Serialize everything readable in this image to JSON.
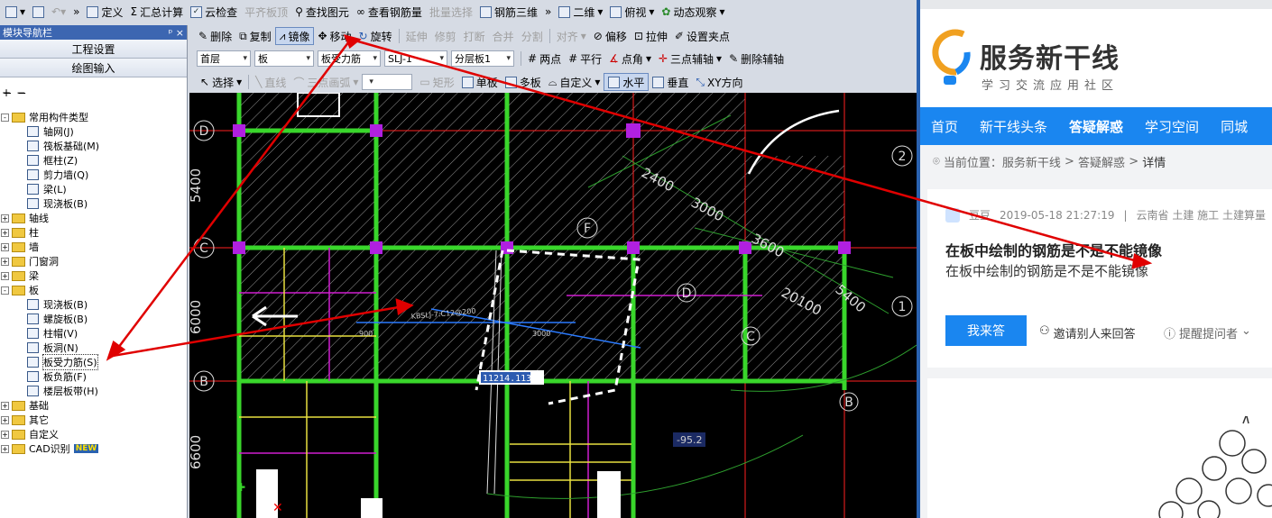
{
  "toolbar1": {
    "define": "定义",
    "sum_calc": "汇总计算",
    "cloud_check": "云检查",
    "align_top": "平齐板顶",
    "find_elem": "查找图元",
    "view_rebar": "查看钢筋量",
    "batch_select": "批量选择",
    "rebar_3d": "钢筋三维",
    "view_2d": "二维",
    "top_view": "俯视",
    "dynamic_view": "动态观察"
  },
  "toolbar2": {
    "delete": "删除",
    "copy": "复制",
    "mirror": "镜像",
    "move": "移动",
    "rotate": "旋转",
    "extend": "延伸",
    "trim": "修剪",
    "break": "打断",
    "merge": "合并",
    "split": "分割",
    "align": "对齐",
    "offset": "偏移",
    "stretch": "拉伸",
    "set_grip": "设置夹点"
  },
  "toolbar3": {
    "floor": "首层",
    "category": "板",
    "type": "板受力筋",
    "item": "SLJ-1",
    "layer": "分层板1",
    "two_point": "两点",
    "parallel": "平行",
    "point_angle": "点角",
    "three_point_axis": "三点辅轴",
    "delete_axis": "删除辅轴"
  },
  "toolbar4": {
    "select": "选择",
    "line": "直线",
    "arc3": "三点画弧",
    "rect": "矩形",
    "single_board": "单板",
    "multi_board": "多板",
    "custom": "自定义",
    "horizontal": "水平",
    "vertical": "垂直",
    "xy_dir": "XY方向"
  },
  "nav": {
    "title": "模块导航栏",
    "pin": "ᵖ ×",
    "btn1": "工程设置",
    "btn2": "绘图输入"
  },
  "tree": [
    {
      "level": 0,
      "sign": "-",
      "label": "常用构件类型"
    },
    {
      "level": 1,
      "label": "轴网(J)"
    },
    {
      "level": 1,
      "label": "筏板基础(M)"
    },
    {
      "level": 1,
      "label": "框柱(Z)"
    },
    {
      "level": 1,
      "label": "剪力墙(Q)"
    },
    {
      "level": 1,
      "label": "梁(L)"
    },
    {
      "level": 1,
      "label": "现浇板(B)"
    },
    {
      "level": 0,
      "sign": "+",
      "label": "轴线"
    },
    {
      "level": 0,
      "sign": "+",
      "label": "柱"
    },
    {
      "level": 0,
      "sign": "+",
      "label": "墙"
    },
    {
      "level": 0,
      "sign": "+",
      "label": "门窗洞"
    },
    {
      "level": 0,
      "sign": "+",
      "label": "梁"
    },
    {
      "level": 0,
      "sign": "-",
      "label": "板"
    },
    {
      "level": 1,
      "label": "现浇板(B)"
    },
    {
      "level": 1,
      "label": "螺旋板(B)"
    },
    {
      "level": 1,
      "label": "柱帽(V)"
    },
    {
      "level": 1,
      "label": "板洞(N)"
    },
    {
      "level": 1,
      "label": "板受力筋(S)",
      "selected": true
    },
    {
      "level": 1,
      "label": "板负筋(F)"
    },
    {
      "level": 1,
      "label": "楼层板带(H)"
    },
    {
      "level": 0,
      "sign": "+",
      "label": "基础"
    },
    {
      "level": 0,
      "sign": "+",
      "label": "其它"
    },
    {
      "level": 0,
      "sign": "+",
      "label": "自定义"
    },
    {
      "level": 0,
      "sign": "+",
      "label": "CAD识别",
      "badge": "NEW"
    }
  ],
  "canvas": {
    "axis_D": "D",
    "axis_C": "C",
    "axis_B": "B",
    "axis_F": "F",
    "axis_2": "2",
    "axis_1": "1",
    "dim_5400_left": "5400",
    "dim_6000_left": "6000",
    "dim_6600_left": "6600",
    "dim_2400": "2400",
    "dim_3000": "3000",
    "dim_3600": "3600",
    "dim_20100": "20100",
    "dim_5400": "5400",
    "rebar_label": "KBSLJ-7:C12@200",
    "dim_900": "900",
    "dim_3000b": "3000",
    "input_value": "11214.113",
    "elev": "-95.2",
    "axis_D2": "D",
    "axis_C2": "C",
    "axis_B2": "B"
  },
  "web": {
    "logo_main": "服务新干线",
    "logo_sub": "学习交流应用社区",
    "menu": [
      "首页",
      "新干线头条",
      "答疑解惑",
      "学习空间",
      "同城"
    ],
    "crumb_label": "当前位置：",
    "crumb": [
      "服务新干线",
      ">",
      "答疑解惑",
      ">",
      "详情"
    ],
    "user": "豆豆",
    "date": "2019-05-18 21:27:19",
    "sep": "|",
    "tags": "云南省 土建 施工 土建算量",
    "title": "在板中绘制的钢筋是不是不能镜像",
    "body": "在板中绘制的钢筋是不是不能镜像",
    "answer_btn": "我来答",
    "invite": "邀请别人来回答",
    "remind": "提醒提问者"
  },
  "colors": {
    "accent": "#1a86f0",
    "arrow": "#e00000",
    "beam": "#39d62b",
    "grid": "#ff2020",
    "magenta": "#d01ed0"
  }
}
